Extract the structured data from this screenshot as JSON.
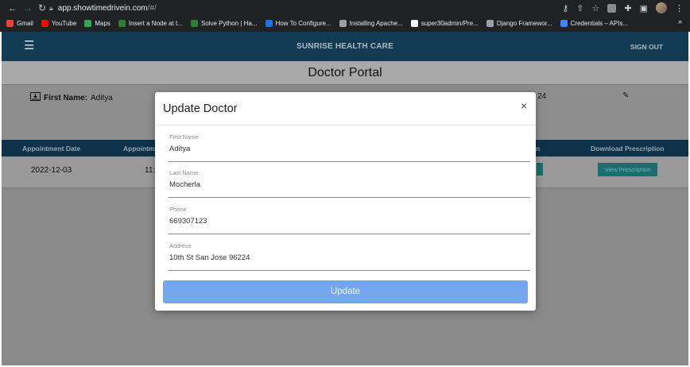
{
  "browser": {
    "url_host": "app.showtimedrivein.com",
    "url_path": "/#/",
    "bookmarks": [
      {
        "label": "Gmail",
        "color": "#ea4335"
      },
      {
        "label": "YouTube",
        "color": "#ff0000"
      },
      {
        "label": "Maps",
        "color": "#34a853"
      },
      {
        "label": "Insert a Node at t...",
        "color": "#2e7d32"
      },
      {
        "label": "Solve Python | Ha...",
        "color": "#2e7d32"
      },
      {
        "label": "How To Configure...",
        "color": "#1a73e8"
      },
      {
        "label": "Installing Apache...",
        "color": "#9aa0a6"
      },
      {
        "label": "super30admin/Pre...",
        "color": "#ffffff"
      },
      {
        "label": "Django Framewor...",
        "color": "#9aa0a6"
      },
      {
        "label": "Credentials – APIs...",
        "color": "#4285f4"
      }
    ],
    "more": "»"
  },
  "app": {
    "brand": "SUNRISE HEALTH CARE",
    "signout": "SIGN OUT",
    "page_title": "Doctor Portal",
    "first_name_label": "First Name:",
    "first_name_value": "Aditya",
    "zip_fragment": "24",
    "table": {
      "headers": [
        "Appointment Date",
        "Appointm",
        "n",
        "Download Prescription"
      ],
      "row": {
        "date": "2022-12-03",
        "time_fragment": "11:",
        "view_label": "View Prescription"
      }
    }
  },
  "modal": {
    "title": "Update Doctor",
    "close": "×",
    "fields": [
      {
        "label": "First Name",
        "value": "Aditya"
      },
      {
        "label": "Last Name",
        "value": "Mocherla"
      },
      {
        "label": "Phone",
        "value": "669307123"
      },
      {
        "label": "Address",
        "value": "10th St San Jose 96224"
      }
    ],
    "submit_label": "Update"
  },
  "colors": {
    "appbar": "#123b54",
    "table_header": "#0e3249",
    "accent_button": "#73a6ec",
    "teal_button": "#1b6d6e"
  }
}
